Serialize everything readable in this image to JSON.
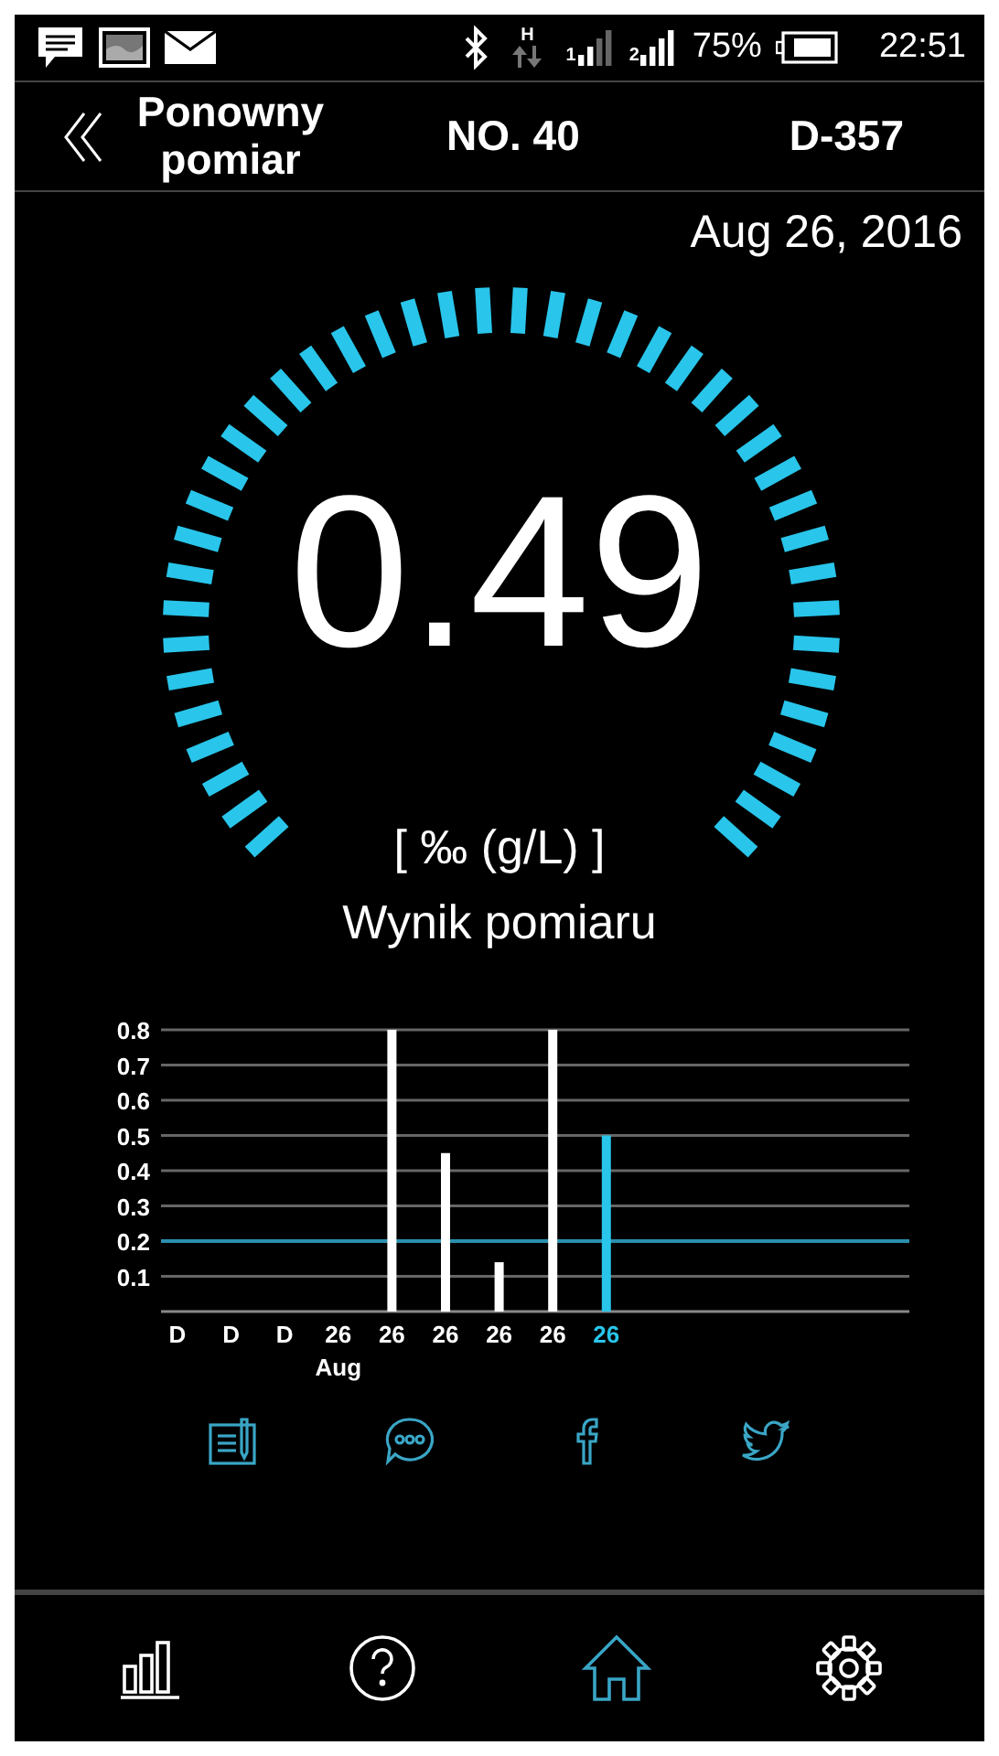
{
  "status_bar": {
    "network_type": "H",
    "sims": [
      {
        "label": "1"
      },
      {
        "label": "2"
      }
    ],
    "battery_percent": "75%",
    "time": "22:51"
  },
  "header": {
    "back_label": "Ponowny pomiar",
    "number": "NO. 40",
    "device": "D-357"
  },
  "date": "Aug 26, 2016",
  "reading": {
    "value": "0.49",
    "unit": "[ ‰ (g/L) ]",
    "label": "Wynik pomiaru"
  },
  "history": {
    "month_label": "Aug",
    "chart_data": {
      "type": "bar",
      "categories": [
        "D",
        "D",
        "D",
        "26",
        "26",
        "26",
        "26",
        "26",
        "26"
      ],
      "series": [
        {
          "color": "#ffffff",
          "values": [
            null,
            null,
            null,
            null,
            0.8,
            0.45,
            0.14,
            0.8,
            null
          ]
        },
        {
          "color": "#29c5ea",
          "values": [
            null,
            null,
            null,
            null,
            null,
            null,
            null,
            null,
            0.5
          ]
        }
      ],
      "stacked": true,
      "ylim": [
        0,
        0.8
      ],
      "yticks": [
        0.1,
        0.2,
        0.3,
        0.4,
        0.5,
        0.6,
        0.7,
        0.8
      ],
      "grid": true,
      "ref_lines": [
        {
          "axis": "y",
          "value": 0.2,
          "color": "#2a8fae"
        }
      ]
    }
  },
  "share": [
    {
      "kind": "notes"
    },
    {
      "kind": "message"
    },
    {
      "kind": "facebook"
    },
    {
      "kind": "twitter"
    }
  ],
  "nav": [
    {
      "kind": "history",
      "selected": false
    },
    {
      "kind": "help",
      "selected": false
    },
    {
      "kind": "home",
      "selected": true
    },
    {
      "kind": "settings",
      "selected": false
    }
  ]
}
